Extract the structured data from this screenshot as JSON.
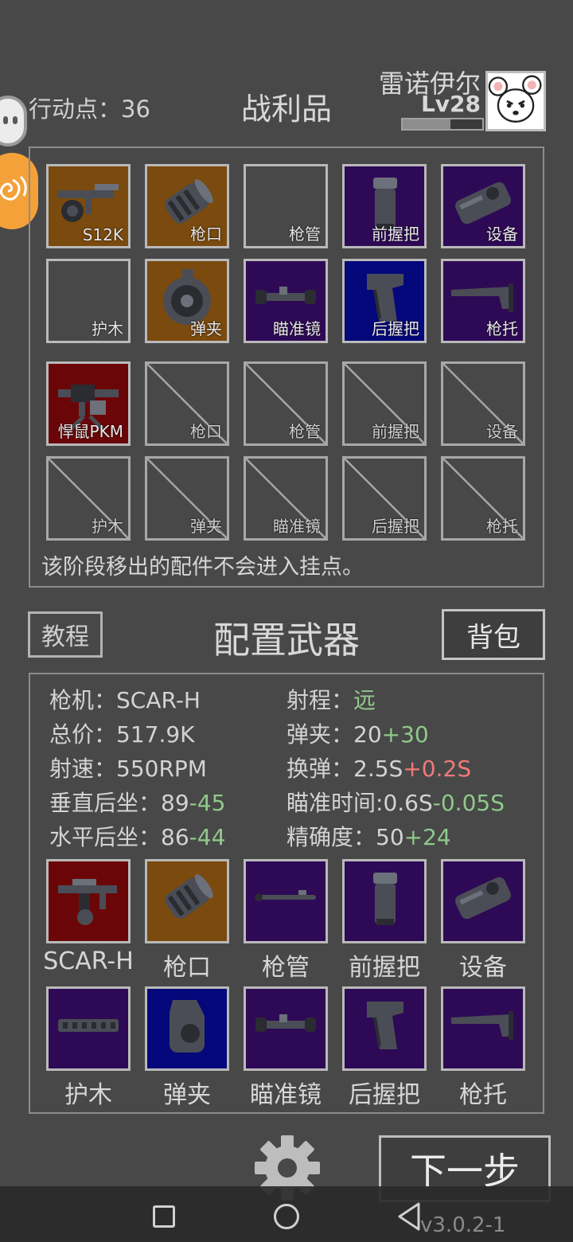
{
  "header": {
    "action_points_label": "行动点：36",
    "title": "战利品",
    "player_name": "雷诺伊尔",
    "player_level": "Lv28",
    "xp_progress": 0.6
  },
  "loot": {
    "weapon1": {
      "slots": [
        {
          "label": "S12K",
          "rarity": "orange",
          "icon": "shotgun-icon"
        },
        {
          "label": "枪口",
          "rarity": "orange",
          "icon": "muzzle-icon"
        },
        {
          "label": "枪管",
          "rarity": "empty",
          "icon": null
        },
        {
          "label": "前握把",
          "rarity": "purple",
          "icon": "foregrip-icon"
        },
        {
          "label": "设备",
          "rarity": "purple",
          "icon": "device-icon"
        },
        {
          "label": "护木",
          "rarity": "empty",
          "icon": null
        },
        {
          "label": "弹夹",
          "rarity": "orange",
          "icon": "drum-magazine-icon"
        },
        {
          "label": "瞄准镜",
          "rarity": "purple",
          "icon": "scope-icon"
        },
        {
          "label": "后握把",
          "rarity": "blue",
          "icon": "rear-grip-icon"
        },
        {
          "label": "枪托",
          "rarity": "purple",
          "icon": "stock-icon"
        }
      ]
    },
    "weapon2": {
      "slots": [
        {
          "label": "悍鼠PKM",
          "rarity": "red",
          "icon": "machine-gun-icon"
        },
        {
          "label": "枪口",
          "rarity": "disabled"
        },
        {
          "label": "枪管",
          "rarity": "disabled"
        },
        {
          "label": "前握把",
          "rarity": "disabled"
        },
        {
          "label": "设备",
          "rarity": "disabled"
        },
        {
          "label": "护木",
          "rarity": "disabled"
        },
        {
          "label": "弹夹",
          "rarity": "disabled"
        },
        {
          "label": "瞄准镜",
          "rarity": "disabled"
        },
        {
          "label": "后握把",
          "rarity": "disabled"
        },
        {
          "label": "枪托",
          "rarity": "disabled"
        }
      ]
    },
    "note": "该阶段移出的配件不会进入挂点。"
  },
  "config": {
    "tutorial_label": "教程",
    "title": "配置武器",
    "bag_label": "背包",
    "stats": {
      "gun_label": "枪机：",
      "gun_value": "SCAR-H",
      "price_label": "总价：",
      "price_value": "517.9K",
      "rate_label": "射速：",
      "rate_value": "550RPM",
      "vrecoil_label": "垂直后坐：",
      "vrecoil_value": "89",
      "vrecoil_mod": "-45",
      "hrecoil_label": "水平后坐：",
      "hrecoil_value": "86",
      "hrecoil_mod": "-44",
      "range_label": "射程：",
      "range_value": "远",
      "mag_label": "弹夹：",
      "mag_value": "20",
      "mag_mod": "+30",
      "reload_label": "换弹：",
      "reload_value": "2.5S",
      "reload_mod": "+0.2S",
      "aim_label": "瞄准时间:",
      "aim_value": "0.6S",
      "aim_mod": "-0.05S",
      "acc_label": "精确度：",
      "acc_value": "50",
      "acc_mod": "+24"
    },
    "equipment": [
      {
        "label": "SCAR-H",
        "rarity": "red",
        "icon": "rifle-icon"
      },
      {
        "label": "枪口",
        "rarity": "orange",
        "icon": "muzzle-icon"
      },
      {
        "label": "枪管",
        "rarity": "purple",
        "icon": "barrel-icon"
      },
      {
        "label": "前握把",
        "rarity": "purple",
        "icon": "foregrip-icon"
      },
      {
        "label": "设备",
        "rarity": "purple",
        "icon": "device-icon"
      },
      {
        "label": "护木",
        "rarity": "purple",
        "icon": "handguard-icon"
      },
      {
        "label": "弹夹",
        "rarity": "blue",
        "icon": "magazine-icon"
      },
      {
        "label": "瞄准镜",
        "rarity": "purple",
        "icon": "scope-icon"
      },
      {
        "label": "后握把",
        "rarity": "purple",
        "icon": "rear-grip-icon"
      },
      {
        "label": "枪托",
        "rarity": "purple",
        "icon": "stock-icon"
      }
    ]
  },
  "footer": {
    "next_label": "下一步",
    "version": "v3.0.2-1"
  },
  "colors": {
    "background": "#484848",
    "orange": "#7a4a0e",
    "purple": "#2e0a56",
    "blue": "#05087a",
    "red": "#6b0608",
    "positive": "#8fc98a",
    "negative": "#f07a7a"
  }
}
